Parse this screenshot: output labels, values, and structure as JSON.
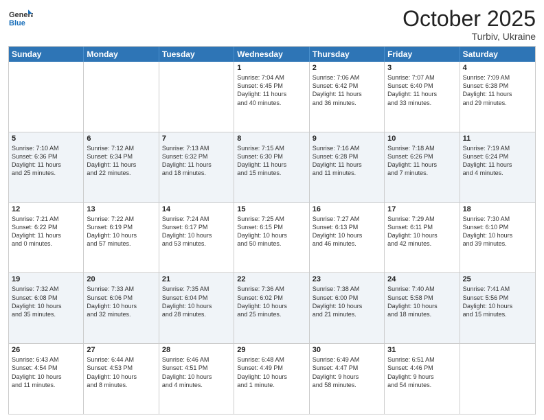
{
  "header": {
    "logo_line1": "General",
    "logo_line2": "Blue",
    "month": "October 2025",
    "location": "Turbiv, Ukraine"
  },
  "weekdays": [
    "Sunday",
    "Monday",
    "Tuesday",
    "Wednesday",
    "Thursday",
    "Friday",
    "Saturday"
  ],
  "rows": [
    [
      {
        "day": "",
        "text": ""
      },
      {
        "day": "",
        "text": ""
      },
      {
        "day": "",
        "text": ""
      },
      {
        "day": "1",
        "text": "Sunrise: 7:04 AM\nSunset: 6:45 PM\nDaylight: 11 hours\nand 40 minutes."
      },
      {
        "day": "2",
        "text": "Sunrise: 7:06 AM\nSunset: 6:42 PM\nDaylight: 11 hours\nand 36 minutes."
      },
      {
        "day": "3",
        "text": "Sunrise: 7:07 AM\nSunset: 6:40 PM\nDaylight: 11 hours\nand 33 minutes."
      },
      {
        "day": "4",
        "text": "Sunrise: 7:09 AM\nSunset: 6:38 PM\nDaylight: 11 hours\nand 29 minutes."
      }
    ],
    [
      {
        "day": "5",
        "text": "Sunrise: 7:10 AM\nSunset: 6:36 PM\nDaylight: 11 hours\nand 25 minutes."
      },
      {
        "day": "6",
        "text": "Sunrise: 7:12 AM\nSunset: 6:34 PM\nDaylight: 11 hours\nand 22 minutes."
      },
      {
        "day": "7",
        "text": "Sunrise: 7:13 AM\nSunset: 6:32 PM\nDaylight: 11 hours\nand 18 minutes."
      },
      {
        "day": "8",
        "text": "Sunrise: 7:15 AM\nSunset: 6:30 PM\nDaylight: 11 hours\nand 15 minutes."
      },
      {
        "day": "9",
        "text": "Sunrise: 7:16 AM\nSunset: 6:28 PM\nDaylight: 11 hours\nand 11 minutes."
      },
      {
        "day": "10",
        "text": "Sunrise: 7:18 AM\nSunset: 6:26 PM\nDaylight: 11 hours\nand 7 minutes."
      },
      {
        "day": "11",
        "text": "Sunrise: 7:19 AM\nSunset: 6:24 PM\nDaylight: 11 hours\nand 4 minutes."
      }
    ],
    [
      {
        "day": "12",
        "text": "Sunrise: 7:21 AM\nSunset: 6:22 PM\nDaylight: 11 hours\nand 0 minutes."
      },
      {
        "day": "13",
        "text": "Sunrise: 7:22 AM\nSunset: 6:19 PM\nDaylight: 10 hours\nand 57 minutes."
      },
      {
        "day": "14",
        "text": "Sunrise: 7:24 AM\nSunset: 6:17 PM\nDaylight: 10 hours\nand 53 minutes."
      },
      {
        "day": "15",
        "text": "Sunrise: 7:25 AM\nSunset: 6:15 PM\nDaylight: 10 hours\nand 50 minutes."
      },
      {
        "day": "16",
        "text": "Sunrise: 7:27 AM\nSunset: 6:13 PM\nDaylight: 10 hours\nand 46 minutes."
      },
      {
        "day": "17",
        "text": "Sunrise: 7:29 AM\nSunset: 6:11 PM\nDaylight: 10 hours\nand 42 minutes."
      },
      {
        "day": "18",
        "text": "Sunrise: 7:30 AM\nSunset: 6:10 PM\nDaylight: 10 hours\nand 39 minutes."
      }
    ],
    [
      {
        "day": "19",
        "text": "Sunrise: 7:32 AM\nSunset: 6:08 PM\nDaylight: 10 hours\nand 35 minutes."
      },
      {
        "day": "20",
        "text": "Sunrise: 7:33 AM\nSunset: 6:06 PM\nDaylight: 10 hours\nand 32 minutes."
      },
      {
        "day": "21",
        "text": "Sunrise: 7:35 AM\nSunset: 6:04 PM\nDaylight: 10 hours\nand 28 minutes."
      },
      {
        "day": "22",
        "text": "Sunrise: 7:36 AM\nSunset: 6:02 PM\nDaylight: 10 hours\nand 25 minutes."
      },
      {
        "day": "23",
        "text": "Sunrise: 7:38 AM\nSunset: 6:00 PM\nDaylight: 10 hours\nand 21 minutes."
      },
      {
        "day": "24",
        "text": "Sunrise: 7:40 AM\nSunset: 5:58 PM\nDaylight: 10 hours\nand 18 minutes."
      },
      {
        "day": "25",
        "text": "Sunrise: 7:41 AM\nSunset: 5:56 PM\nDaylight: 10 hours\nand 15 minutes."
      }
    ],
    [
      {
        "day": "26",
        "text": "Sunrise: 6:43 AM\nSunset: 4:54 PM\nDaylight: 10 hours\nand 11 minutes."
      },
      {
        "day": "27",
        "text": "Sunrise: 6:44 AM\nSunset: 4:53 PM\nDaylight: 10 hours\nand 8 minutes."
      },
      {
        "day": "28",
        "text": "Sunrise: 6:46 AM\nSunset: 4:51 PM\nDaylight: 10 hours\nand 4 minutes."
      },
      {
        "day": "29",
        "text": "Sunrise: 6:48 AM\nSunset: 4:49 PM\nDaylight: 10 hours\nand 1 minute."
      },
      {
        "day": "30",
        "text": "Sunrise: 6:49 AM\nSunset: 4:47 PM\nDaylight: 9 hours\nand 58 minutes."
      },
      {
        "day": "31",
        "text": "Sunrise: 6:51 AM\nSunset: 4:46 PM\nDaylight: 9 hours\nand 54 minutes."
      },
      {
        "day": "",
        "text": ""
      }
    ]
  ]
}
